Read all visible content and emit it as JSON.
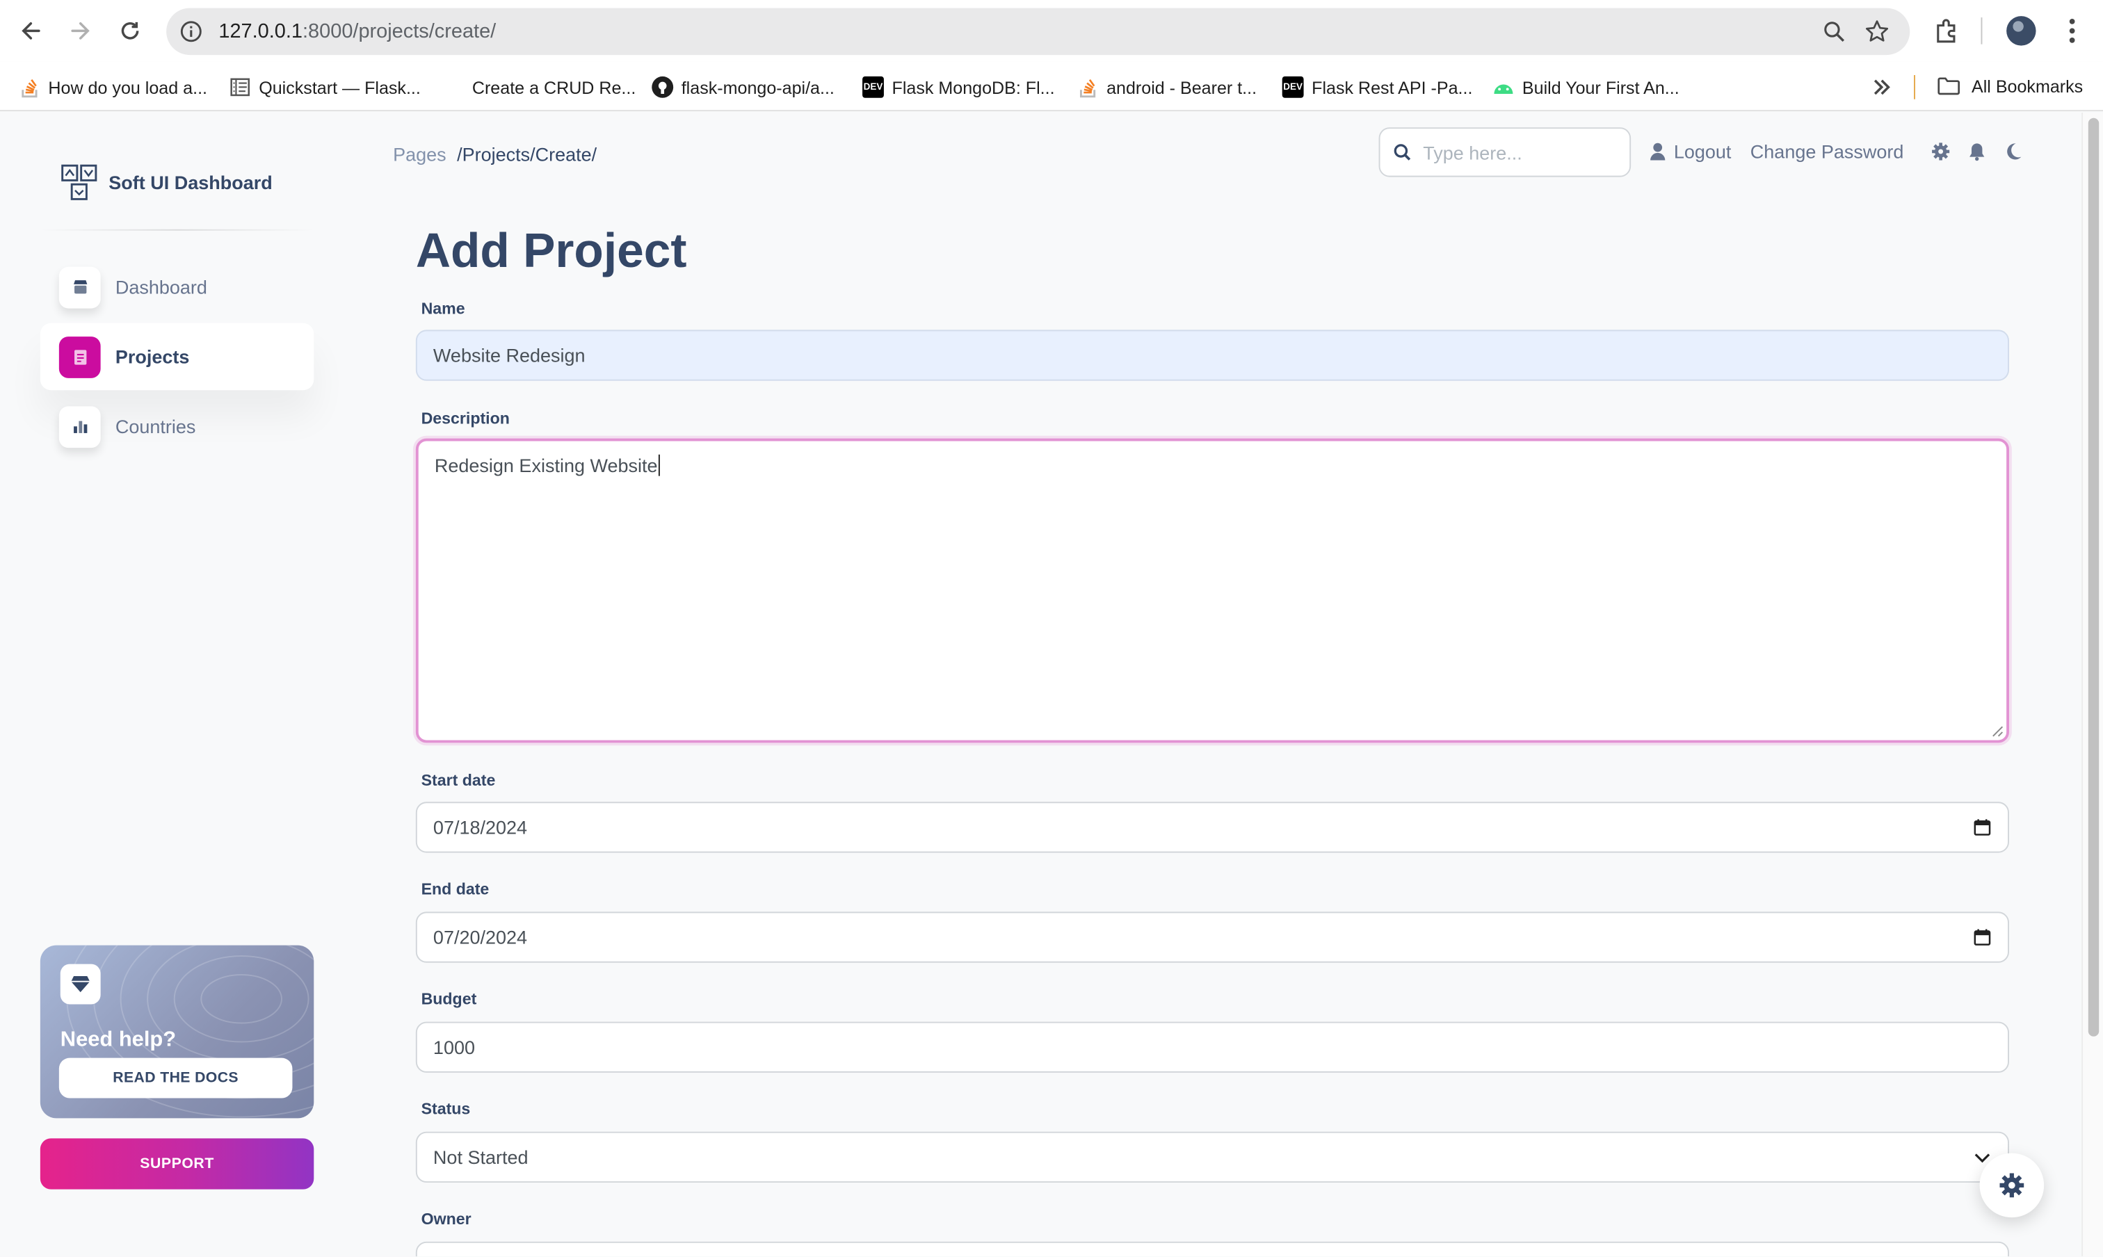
{
  "browser": {
    "url_host": "127.0.0.1",
    "url_rest": ":8000/projects/create/",
    "bookmarks": [
      {
        "label": "How do you load a...",
        "icon": "stackoverflow-icon"
      },
      {
        "label": "Quickstart — Flask...",
        "icon": "book-icon"
      },
      {
        "label": "Create a CRUD Re...",
        "icon": "blank-icon"
      },
      {
        "label": "flask-mongo-api/a...",
        "icon": "github-icon"
      },
      {
        "label": "Flask MongoDB: Fl...",
        "icon": "dev-icon"
      },
      {
        "label": "android - Bearer t...",
        "icon": "stackoverflow-icon"
      },
      {
        "label": "Flask Rest API -Pa...",
        "icon": "dev-icon"
      },
      {
        "label": "Build Your First An...",
        "icon": "android-icon"
      }
    ],
    "all_bookmarks": "All Bookmarks"
  },
  "sidebar": {
    "brand": "Soft UI Dashboard",
    "items": [
      {
        "label": "Dashboard",
        "icon": "shop-icon"
      },
      {
        "label": "Projects",
        "icon": "document-icon"
      },
      {
        "label": "Countries",
        "icon": "chart-icon"
      }
    ],
    "help_title": "Need help?",
    "help_button": "READ THE DOCS",
    "support_button": "SUPPORT"
  },
  "topnav": {
    "breadcrumb_root": "Pages",
    "breadcrumb_current": "/Projects/Create/",
    "search_placeholder": "Type here...",
    "logout": "Logout",
    "change_password": "Change Password"
  },
  "form": {
    "title": "Add Project",
    "name_label": "Name",
    "name_value": "Website Redesign",
    "description_label": "Description",
    "description_value": "Redesign Existing Website",
    "start_label": "Start date",
    "start_value": "07/18/2024",
    "end_label": "End date",
    "end_value": "07/20/2024",
    "budget_label": "Budget",
    "budget_value": "1000",
    "status_label": "Status",
    "status_value": "Not Started",
    "owner_label": "Owner"
  },
  "colors": {
    "primary": "#cb0c9f",
    "text": "#344767",
    "muted": "#67748e"
  }
}
